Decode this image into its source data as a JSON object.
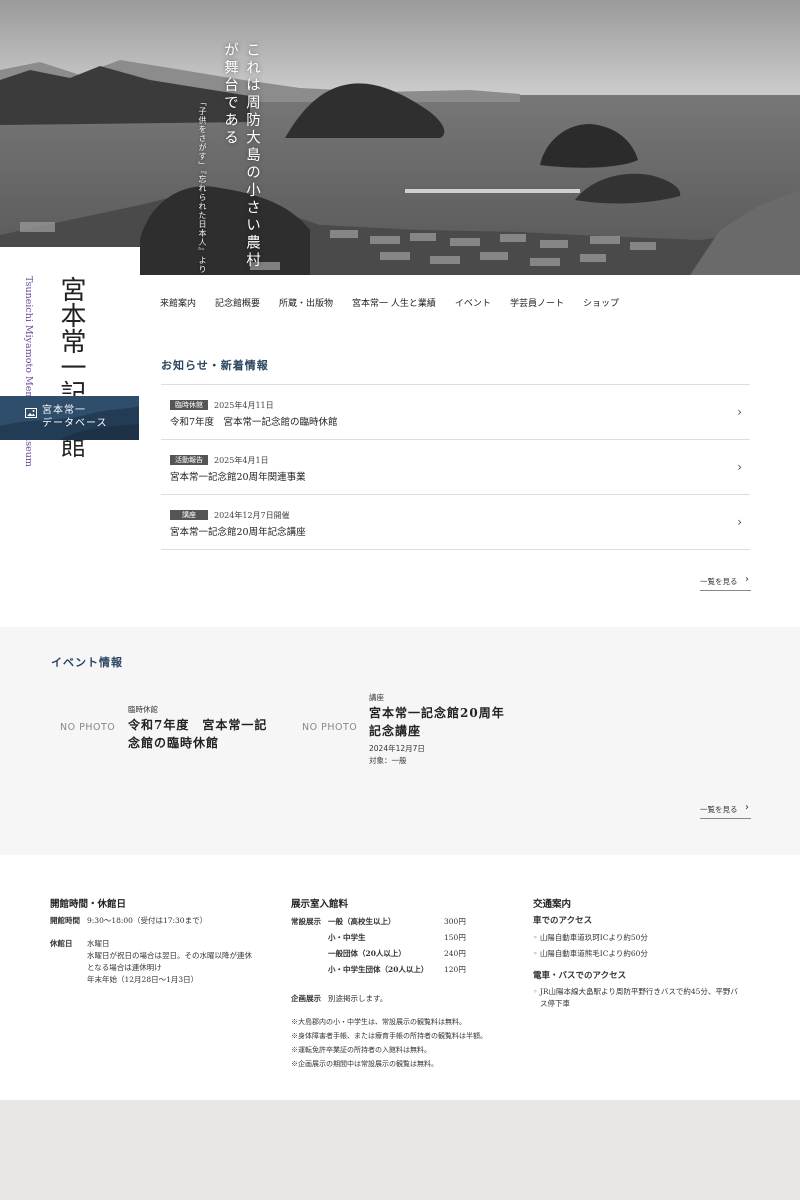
{
  "hero": {
    "tagline": "これは周防大島の小さい農村が舞台である",
    "sub_tagline": "「子供をさがす」『忘れられた日本人』より"
  },
  "logo": {
    "name_jp": "宮本常一記念館",
    "name_en": "Tsuneichi Miyamoto Memorial Museum"
  },
  "database_banner": {
    "label_line1": "宮本常一",
    "label_line2": "データベース"
  },
  "nav": {
    "items": [
      "来館案内",
      "記念館概要",
      "所蔵・出版物",
      "宮本常一 人生と業績",
      "イベント",
      "学芸員ノート",
      "ショップ"
    ]
  },
  "news": {
    "title": "お知らせ・新着情報",
    "items": [
      {
        "badge": "臨時休館",
        "date": "2025年4月11日",
        "title": "令和7年度　宮本常一記念館の臨時休館"
      },
      {
        "badge": "活動報告",
        "date": "2025年4月1日",
        "title": "宮本常一記念館20周年関連事業"
      },
      {
        "badge": "講座",
        "date": "2024年12月7日開催",
        "title": "宮本常一記念館20周年記念講座"
      }
    ],
    "more": "一覧を見る"
  },
  "events": {
    "title": "イベント情報",
    "items": [
      {
        "photo": "NO PHOTO",
        "category": "臨時休館",
        "name_line1": "令和7年度　宮本常一記",
        "name_line2": "念館の臨時休館",
        "date": "",
        "target": ""
      },
      {
        "photo": "NO PHOTO",
        "category": "講座",
        "name_line1": "宮本常一記念館20周年",
        "name_line2": "記念講座",
        "date": "2024年12月7日",
        "target": "対象：一般"
      }
    ],
    "more": "一覧を見る"
  },
  "hours": {
    "title": "開館時間・休館日",
    "open_label": "開館時間",
    "open_value": "9:30〜18:00（受付は17:30まで）",
    "closed_label": "休館日",
    "closed_line1": "水曜日",
    "closed_line2": "水曜日が祝日の場合は翌日。その水曜以降が連休",
    "closed_line3": "となる場合は連休明け",
    "closed_line4": "年末年始（12月28日〜1月3日）"
  },
  "fees": {
    "title": "展示室入館料",
    "regular_label": "常設展示",
    "rows": [
      {
        "label": "一般（高校生以上）",
        "price": "300円"
      },
      {
        "label": "小・中学生",
        "price": "150円"
      },
      {
        "label": "一般団体（20人以上）",
        "price": "240円"
      },
      {
        "label": "小・中学生団体（20人以上）",
        "price": "120円"
      }
    ],
    "special_label": "企画展示",
    "special_value": "別途掲示します。",
    "notes": [
      "※大島郡内の小・中学生は、常設展示の観覧料は無料。",
      "※身体障害者手帳、または療育手帳の所持者の観覧料は半額。",
      "※運転免許卒業証の所持者の入館料は無料。",
      "※企画展示の期間中は常設展示の観覧は無料。"
    ]
  },
  "access": {
    "title": "交通案内",
    "car_title": "車でのアクセス",
    "car_items": [
      "山陽自動車道玖珂ICより約50分",
      "山陽自動車道熊毛ICより約60分"
    ],
    "train_title": "電車・バスでのアクセス",
    "train_line1": "JR山陽本線大畠駅より周防平野行きバスで約45分、平野バ",
    "train_line2": "ス停下車"
  }
}
